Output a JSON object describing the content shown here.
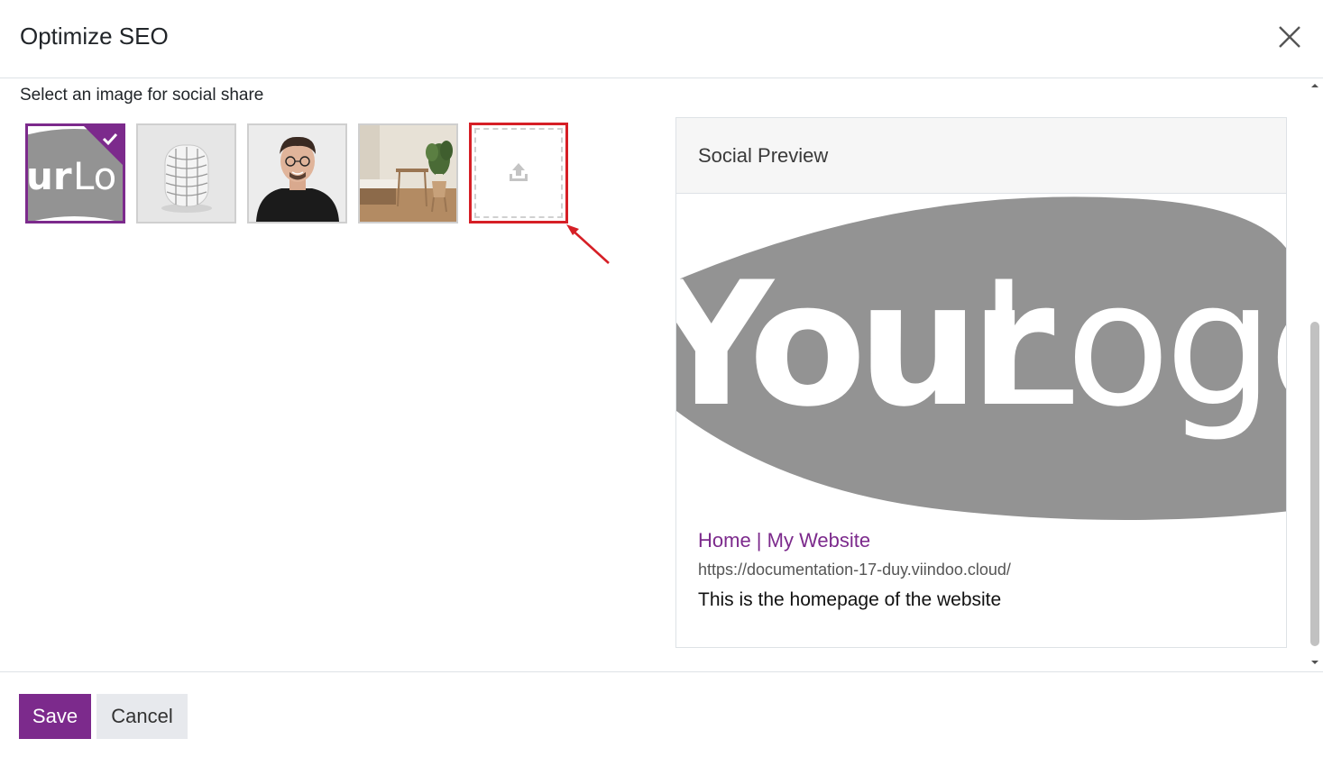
{
  "dialog": {
    "title": "Optimize SEO",
    "close_icon": "close-icon"
  },
  "image_picker": {
    "label": "Select an image for social share",
    "images": [
      {
        "name": "your-logo",
        "selected": true
      },
      {
        "name": "speaker-product",
        "selected": false
      },
      {
        "name": "person-portrait",
        "selected": false
      },
      {
        "name": "bedroom-interior",
        "selected": false
      }
    ],
    "upload_icon": "upload-icon"
  },
  "social_preview": {
    "heading": "Social Preview",
    "title": "Home | My Website",
    "url": "https://documentation-17-duy.viindoo.cloud/",
    "description": "This is the homepage of the website",
    "image_text": "YourLogo"
  },
  "footer": {
    "save_label": "Save",
    "cancel_label": "Cancel"
  },
  "colors": {
    "brand": "#7c2a8c",
    "highlight": "#d61f26"
  }
}
